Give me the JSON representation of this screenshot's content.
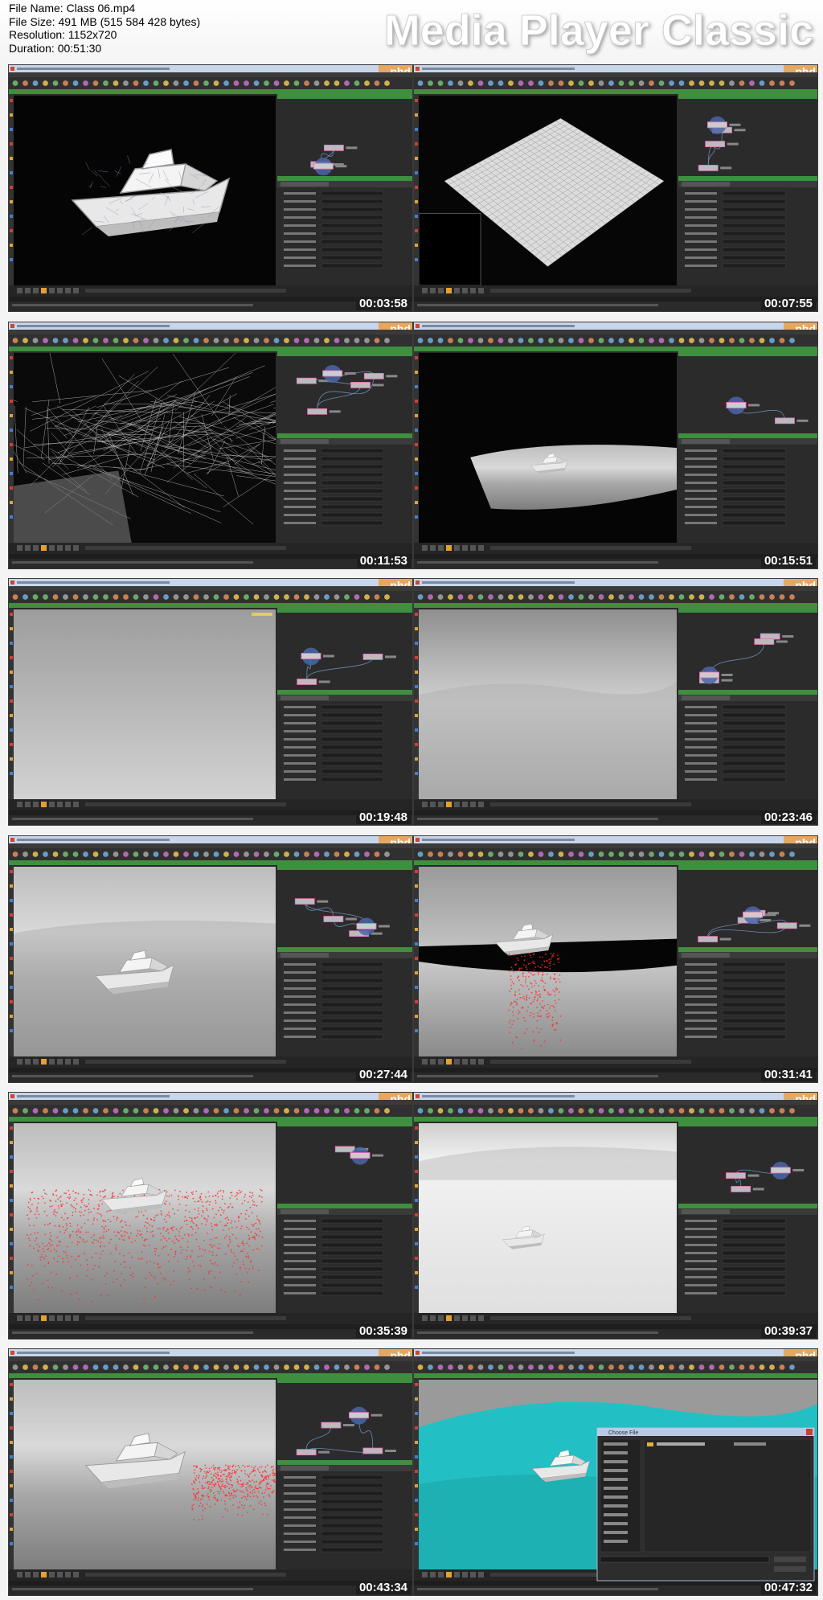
{
  "header": {
    "file_name": "File Name: Class 06.mp4",
    "file_size": "File Size: 491 MB (515 584 428 bytes)",
    "resolution": "Resolution: 1152x720",
    "duration": "Duration: 00:51:30",
    "brand": "Media Player Classic"
  },
  "app": {
    "title_bar": "Houdini Master",
    "logo": "phd",
    "accent_colors": {
      "toolbar_green": "#3f8f3f",
      "panel_dark": "#2d2d2d",
      "title_blue": "#b9cbe6",
      "logo_orange": "#e08a2a"
    }
  },
  "thumbnails": [
    {
      "timestamp": "00:03:58",
      "scene": "boat-wireframe",
      "side": "right"
    },
    {
      "timestamp": "00:07:55",
      "scene": "grid-plane",
      "side": "right"
    },
    {
      "timestamp": "00:11:53",
      "scene": "lines-chaos",
      "side": "right"
    },
    {
      "timestamp": "00:15:51",
      "scene": "ocean-small-boat",
      "side": "right"
    },
    {
      "timestamp": "00:19:48",
      "scene": "gray-empty",
      "side": "right"
    },
    {
      "timestamp": "00:23:46",
      "scene": "ocean-gray",
      "side": "right"
    },
    {
      "timestamp": "00:27:44",
      "scene": "boat-ocean",
      "side": "right"
    },
    {
      "timestamp": "00:31:41",
      "scene": "boat-black-red",
      "side": "right"
    },
    {
      "timestamp": "00:35:39",
      "scene": "boat-red-particles",
      "side": "right"
    },
    {
      "timestamp": "00:39:37",
      "scene": "white-small-boat",
      "side": "right"
    },
    {
      "timestamp": "00:43:34",
      "scene": "boat-red-trail",
      "side": "right"
    },
    {
      "timestamp": "00:47:32",
      "scene": "cyan-dialog",
      "side": "right"
    }
  ],
  "dialog": {
    "title": "Choose File"
  }
}
